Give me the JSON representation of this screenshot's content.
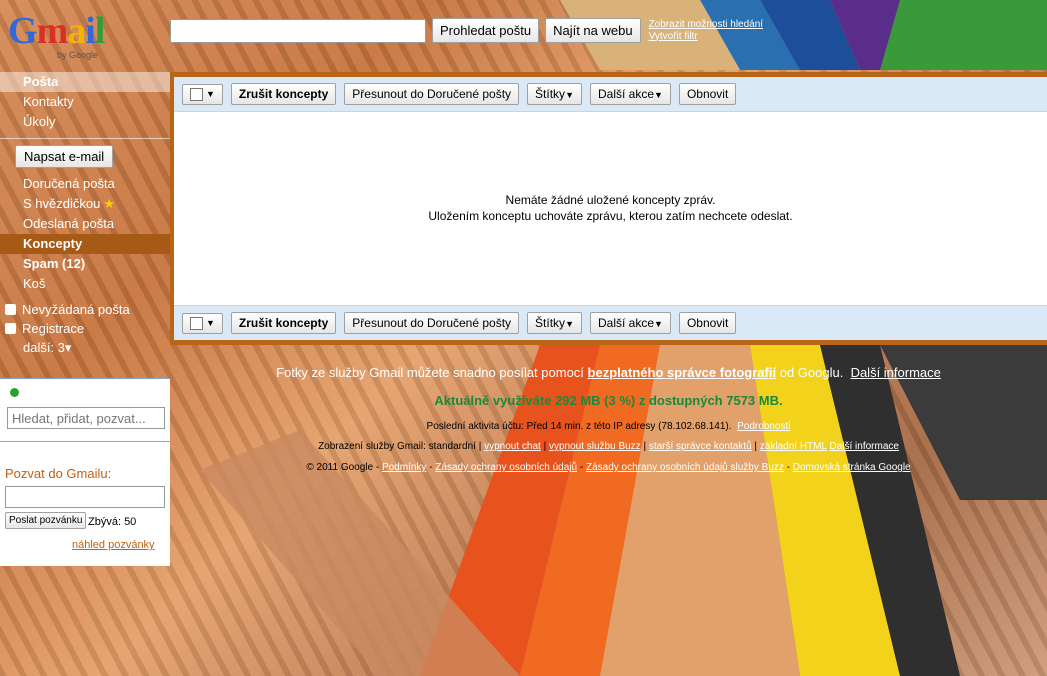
{
  "header": {
    "logo_text": "Gmail",
    "logo_byline": "by Google",
    "search_placeholder": "",
    "search_mail_button": "Prohledat poštu",
    "search_web_button": "Najít na webu",
    "search_options_link": "Zobrazit možnosti hledání",
    "create_filter_link": "Vytvořit filtr"
  },
  "nav": {
    "top_items": [
      "Pošta",
      "Kontakty",
      "Úkoly"
    ],
    "compose_button": "Napsat e-mail",
    "folders": {
      "inbox": "Doručená pošta",
      "starred": "S hvězdičkou",
      "sent": "Odeslaná pošta",
      "drafts": "Koncepty",
      "spam": "Spam (12)",
      "trash": "Koš"
    },
    "labels": [
      "Nevyžádaná pošta",
      "Registrace"
    ],
    "more_label": "další: 3▾"
  },
  "chat": {
    "search_placeholder": "Hledat, přidat, pozvat..."
  },
  "invite": {
    "title": "Pozvat do Gmailu:",
    "send_button": "Poslat pozvánku",
    "remaining": "Zbývá: 50",
    "preview_link": "náhled pozvánky"
  },
  "toolbar": {
    "discard_drafts": "Zrušit koncepty",
    "move_to_inbox": "Přesunout do Doručené pošty",
    "labels": "Štítky",
    "more_actions": "Další akce",
    "refresh": "Obnovit"
  },
  "empty_state": {
    "line1": "Nemáte žádné uložené koncepty zpráv.",
    "line2": "Uložením konceptu uchováte zprávu, kterou zatím nechcete odeslat."
  },
  "footer": {
    "photos_prefix": "Fotky ze služby Gmail můžete snadno posílat pomocí",
    "photos_link": "bezplatného správce fotografií",
    "photos_suffix": "od Googlu.",
    "more_info_link": "Další informace",
    "storage": "Aktuálně využíváte 292 MB (3 %) z dostupných 7573 MB.",
    "last_activity": "Poslední aktivita účtu: Před 14 min. z této IP adresy (78.102.68.141).",
    "details_link": "Podrobnosti",
    "view_label": "Zobrazení služby Gmail: standardní |",
    "view_links": [
      "vypnout chat",
      "vypnout službu Buzz",
      "starší správce kontaktů",
      "základní HTML",
      "Další informace"
    ],
    "copyright": "© 2011 Google -",
    "legal_links": [
      "Podmínky",
      "Zásady ochrany osobních údajů",
      "Zásady ochrany osobních údajů služby Buzz",
      "Domovská stránka Google"
    ]
  }
}
